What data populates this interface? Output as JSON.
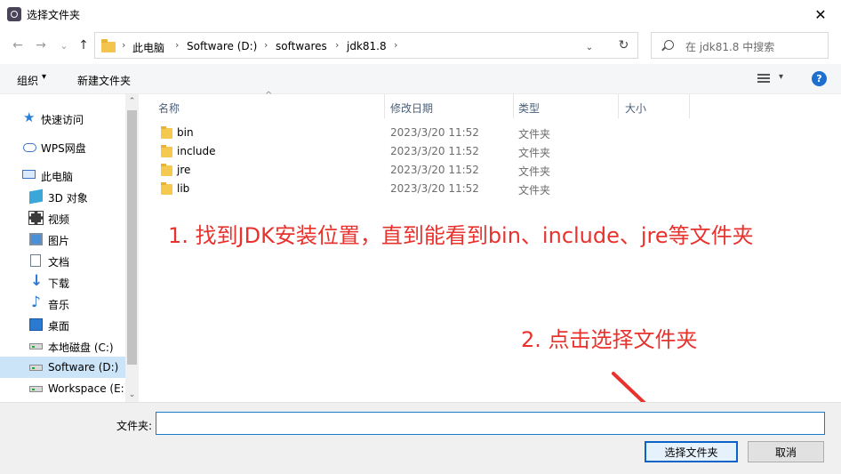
{
  "window": {
    "title": "选择文件夹",
    "close_glyph": "✕"
  },
  "nav": {
    "back_glyph": "←",
    "forward_glyph": "→",
    "dropdown_glyph": "⌄",
    "up_glyph": "↑",
    "breadcrumbs": [
      "此电脑",
      "Software (D:)",
      "softwares",
      "jdk81.8"
    ],
    "separator": "›",
    "address_dropdown_glyph": "⌄",
    "refresh_glyph": "↻",
    "search_placeholder": "在 jdk81.8 中搜索"
  },
  "toolbar": {
    "organize_label": "组织",
    "organize_dd": "▾",
    "new_folder_label": "新建文件夹",
    "view_dd": "▾",
    "help_label": "?"
  },
  "sidebar": {
    "items": [
      {
        "label": "快速访问",
        "icon": "star-icon"
      },
      {
        "label": "WPS网盘",
        "icon": "cloud-icon"
      },
      {
        "label": "此电脑",
        "icon": "computer-icon"
      },
      {
        "label": "3D 对象",
        "icon": "3d-objects-icon"
      },
      {
        "label": "视频",
        "icon": "video-icon"
      },
      {
        "label": "图片",
        "icon": "pictures-icon"
      },
      {
        "label": "文档",
        "icon": "documents-icon"
      },
      {
        "label": "下载",
        "icon": "download-icon"
      },
      {
        "label": "音乐",
        "icon": "music-icon"
      },
      {
        "label": "桌面",
        "icon": "desktop-icon"
      },
      {
        "label": "本地磁盘 (C:)",
        "icon": "drive-icon"
      },
      {
        "label": "Software (D:)",
        "icon": "drive-icon"
      },
      {
        "label": "Workspace (E:)",
        "icon": "drive-icon"
      }
    ],
    "selected_index": 11,
    "scroll_up": "⌃",
    "scroll_down": "⌄"
  },
  "filelist": {
    "columns": [
      "名称",
      "修改日期",
      "类型",
      "大小"
    ],
    "sort_glyph": "^",
    "rows": [
      {
        "name": "bin",
        "date": "2023/3/20 11:52",
        "type": "文件夹"
      },
      {
        "name": "include",
        "date": "2023/3/20 11:52",
        "type": "文件夹"
      },
      {
        "name": "jre",
        "date": "2023/3/20 11:52",
        "type": "文件夹"
      },
      {
        "name": "lib",
        "date": "2023/3/20 11:52",
        "type": "文件夹"
      }
    ]
  },
  "annotations": {
    "step1": "1. 找到JDK安装位置，直到能看到bin、include、jre等文件夹",
    "step2": "2. 点击选择文件夹",
    "color": "#e8322d"
  },
  "footer": {
    "folder_label": "文件夹:",
    "folder_value": "",
    "select_button": "选择文件夹",
    "cancel_button": "取消"
  }
}
